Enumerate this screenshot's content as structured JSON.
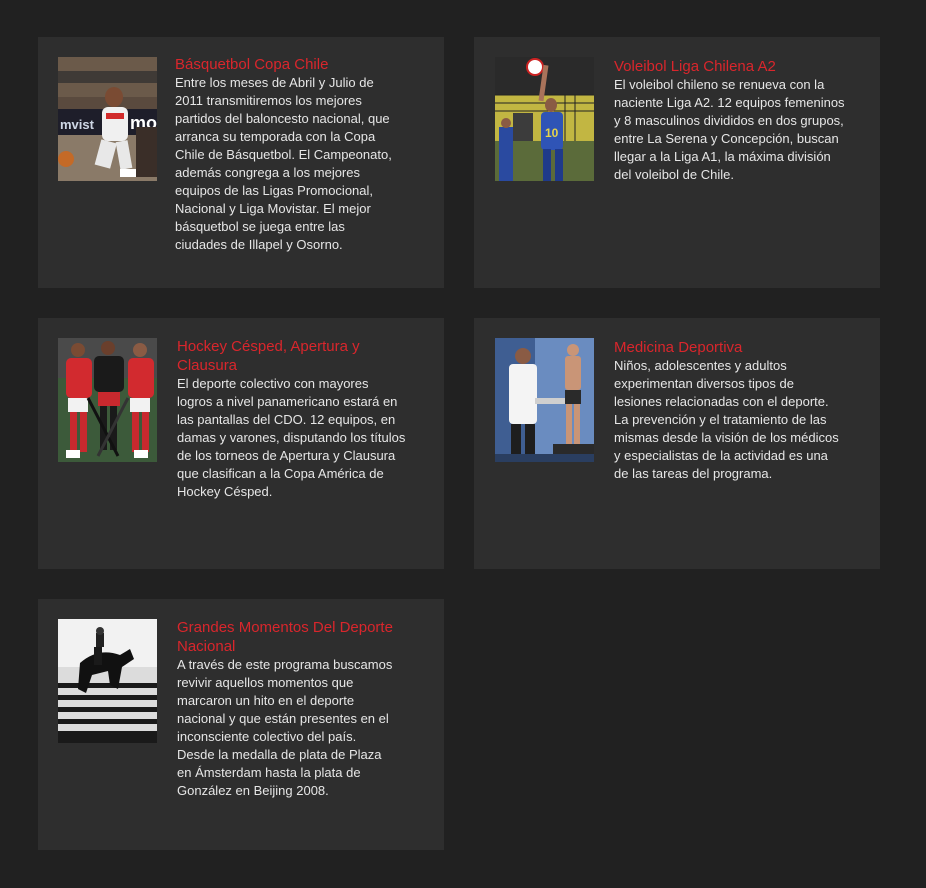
{
  "cards": [
    {
      "title": "Básquetbol Copa Chile",
      "body": "Entre los meses de Abril y Julio de\n2011 transmitiremos los mejores\npartidos del baloncesto nacional, que\narranca su temporada con la Copa\nChile de Básquetbol. El Campeonato,\nademás congrega a los mejores\nequipos de las Ligas Promocional,\nNacional  y Liga Movistar. El mejor\nbásquetbol se juega entre las\nciudades de Illapel y Osorno."
    },
    {
      "title": "Voleibol Liga Chilena A2",
      "body": "El voleibol chileno se renueva con la\nnaciente Liga A2. 12 equipos femeninos\ny 8 masculinos divididos en dos grupos,\nentre La Serena y Concepción, buscan\nllegar a la Liga A1, la máxima división\ndel voleibol de Chile."
    },
    {
      "title": "Hockey Césped, Apertura y\nClausura",
      "body": "El deporte colectivo con mayores\nlogros a nivel panamericano estará en\nlas pantallas del CDO. 12 equipos, en\ndamas y varones, disputando los títulos\nde los torneos de Apertura y Clausura\nque clasifican a la Copa América de\nHockey Césped."
    },
    {
      "title": "Medicina Deportiva",
      "body": "Niños, adolescentes y adultos\nexperimentan diversos tipos de\nlesiones relacionadas con el deporte.\nLa prevención y el tratamiento de las\nmismas desde la visión de los médicos\ny especialistas de la actividad es una\nde las tareas del programa."
    },
    {
      "title": "Grandes Momentos Del Deporte\nNacional",
      "body": "A través de este programa buscamos\nrevivir aquellos momentos que\nmarcaron un hito en el deporte\nnacional y que están presentes en el\ninconsciente colectivo del país.\nDesde la medalla de plata de Plaza\nen Ámsterdam hasta la plata de\nGonzález en Beijing 2008."
    }
  ],
  "colors": {
    "background": "#212121",
    "card": "#2e2e2e",
    "title": "#d9262c",
    "text": "#e6e6e6"
  }
}
